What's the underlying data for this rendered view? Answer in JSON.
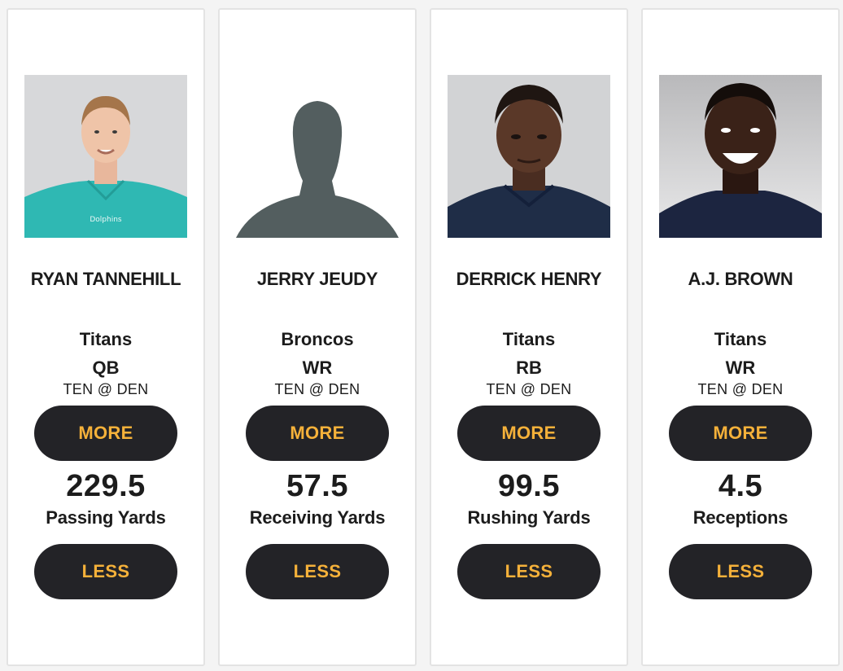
{
  "colors": {
    "button_bg": "#232327",
    "button_text": "#f5b13a",
    "card_border": "#e3e3e3",
    "silhouette": "#535e5f"
  },
  "cards": [
    {
      "player": "RYAN TANNEHILL",
      "team": "Titans",
      "position": "QB",
      "game": "TEN @ DEN",
      "more_label": "MORE",
      "line": "229.5",
      "stat": "Passing Yards",
      "less_label": "LESS",
      "photo": "player-headshot"
    },
    {
      "player": "JERRY JEUDY",
      "team": "Broncos",
      "position": "WR",
      "game": "TEN @ DEN",
      "more_label": "MORE",
      "line": "57.5",
      "stat": "Receiving Yards",
      "less_label": "LESS",
      "photo": "placeholder-silhouette"
    },
    {
      "player": "DERRICK HENRY",
      "team": "Titans",
      "position": "RB",
      "game": "TEN @ DEN",
      "more_label": "MORE",
      "line": "99.5",
      "stat": "Rushing Yards",
      "less_label": "LESS",
      "photo": "player-headshot"
    },
    {
      "player": "A.J. BROWN",
      "team": "Titans",
      "position": "WR",
      "game": "TEN @ DEN",
      "more_label": "MORE",
      "line": "4.5",
      "stat": "Receptions",
      "less_label": "LESS",
      "photo": "player-headshot"
    }
  ]
}
